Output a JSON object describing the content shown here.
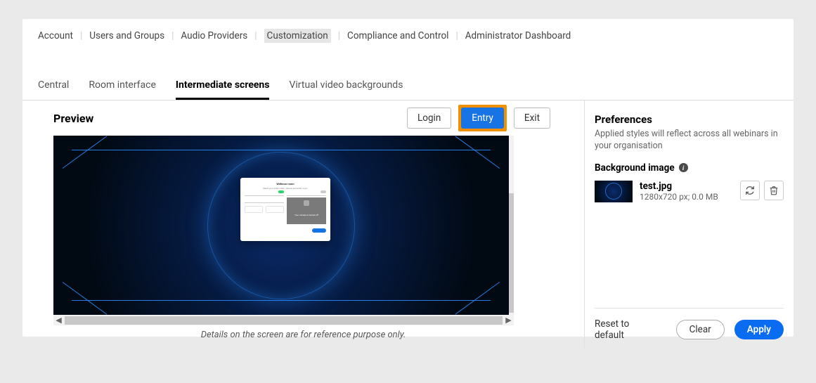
{
  "topNav": {
    "items": [
      "Account",
      "Users and Groups",
      "Audio Providers",
      "Customization",
      "Compliance and Control",
      "Administrator Dashboard"
    ],
    "activeIndex": 3
  },
  "subNav": {
    "tabs": [
      "Central",
      "Room interface",
      "Intermediate screens",
      "Virtual video backgrounds"
    ],
    "activeIndex": 2
  },
  "preview": {
    "title": "Preview",
    "buttons": [
      "Login",
      "Entry",
      "Exit"
    ],
    "activeButtonIndex": 1,
    "modal": {
      "title": "Webinar room",
      "subtitle": "Select your audio/video options and enter room."
    },
    "note": "Details on the screen are for reference purpose only."
  },
  "prefs": {
    "title": "Preferences",
    "desc": "Applied styles will reflect across all webinars in your organisation",
    "bgImageLabel": "Background image",
    "file": {
      "name": "test.jpg",
      "meta": "1280x720 px; 0.0 MB"
    },
    "reset": "Reset to default",
    "clear": "Clear",
    "apply": "Apply"
  }
}
